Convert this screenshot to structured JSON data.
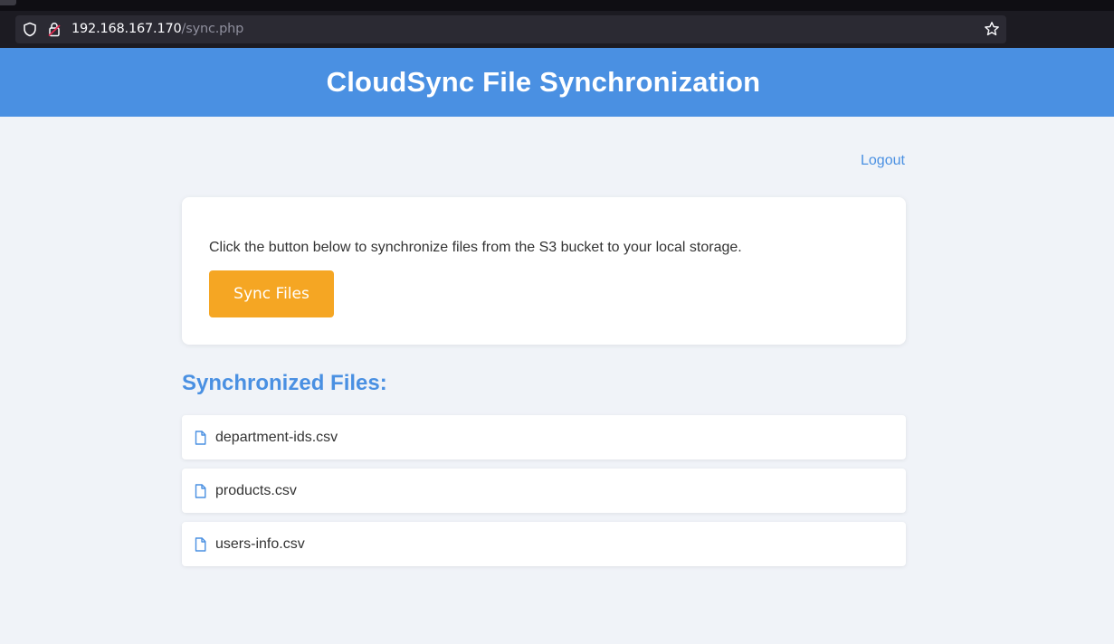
{
  "browser": {
    "url_host": "192.168.167.170",
    "url_path": "/sync.php",
    "icons": [
      "shield-icon",
      "lock-icon",
      "star-icon"
    ]
  },
  "header": {
    "title": "CloudSync File Synchronization",
    "background": "#4a90e2"
  },
  "nav": {
    "logout_label": "Logout"
  },
  "sync_card": {
    "description": "Click the button below to synchronize files from the S3 bucket to your local storage.",
    "button_label": "Sync Files",
    "button_color": "#f5a623"
  },
  "files": {
    "heading": "Synchronized Files:",
    "icon": "file-icon",
    "items": [
      {
        "name": "department-ids.csv"
      },
      {
        "name": "products.csv"
      },
      {
        "name": "users-info.csv"
      }
    ]
  }
}
